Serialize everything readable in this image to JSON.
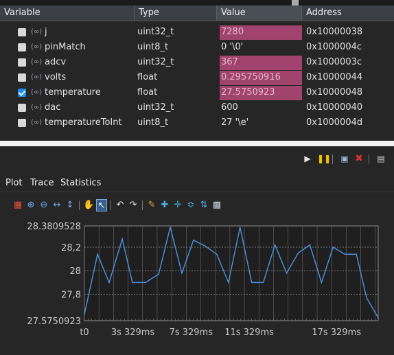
{
  "variables_table": {
    "columns": [
      "Variable",
      "Type",
      "Value",
      "Address"
    ],
    "rows": [
      {
        "name": "j",
        "type": "uint32_t",
        "value": "7280",
        "address": "0x10000038",
        "checked": false,
        "highlight": true
      },
      {
        "name": "pinMatch",
        "type": "uint8_t",
        "value": "0 '\\0'",
        "address": "0x1000004c",
        "checked": false,
        "highlight": false
      },
      {
        "name": "adcv",
        "type": "uint32_t",
        "value": "367",
        "address": "0x1000003c",
        "checked": false,
        "highlight": true
      },
      {
        "name": "volts",
        "type": "float",
        "value": "0.295750916",
        "address": "0x10000044",
        "checked": false,
        "highlight": true
      },
      {
        "name": "temperature",
        "type": "float",
        "value": "27.5750923",
        "address": "0x10000048",
        "checked": true,
        "highlight": true
      },
      {
        "name": "dac",
        "type": "uint32_t",
        "value": "600",
        "address": "0x10000040",
        "checked": false,
        "highlight": false
      },
      {
        "name": "temperatureToInt",
        "type": "uint8_t",
        "value": "27 '\\e'",
        "address": "0x1000004d",
        "checked": false,
        "highlight": false
      }
    ],
    "value_highlight_color": "#a0436d",
    "var_icon_glyph": "(∞)"
  },
  "plot_panel": {
    "tabs": [
      "Plot",
      "Trace",
      "Statistics"
    ],
    "active_tab": "Plot",
    "top_toolbar_icons": [
      "play-icon",
      "pause-icon",
      "save-icon",
      "close-icon",
      "settings-icon"
    ],
    "tool_icons": [
      "export-icon",
      "zoom-in-icon",
      "zoom-out-icon",
      "fit-horizontal-icon",
      "fit-vertical-icon",
      "pan-hand-icon",
      "select-pointer-icon",
      "undo-icon",
      "redo-icon",
      "marker-pen-icon",
      "add-cursor-icon",
      "remove-cursor-icon",
      "measure-icon",
      "scale-icon",
      "snapshot-icon"
    ],
    "active_tool": "select-pointer-icon",
    "line_color": "#4a8fd8"
  },
  "chart_data": {
    "type": "line",
    "ytick_labels": [
      "28.3809528",
      "28,2",
      "28",
      "27,8",
      "27.5750923"
    ],
    "ytick_values": [
      28.3809528,
      28.2,
      28.0,
      27.8,
      27.5750923
    ],
    "xtick_labels": [
      "t0",
      "3s 329ms",
      "7s 329ms",
      "11s 329ms",
      "17s 329ms"
    ],
    "xtick_values": [
      0,
      3.329,
      7.329,
      11.329,
      17.329
    ],
    "ylim": [
      27.5750923,
      28.3809528
    ],
    "xlim": [
      0,
      20.2
    ],
    "grid": true,
    "series": [
      {
        "x": [
          0,
          0.9,
          1.7,
          2.6,
          3.3,
          4.2,
          5.1,
          5.9,
          6.7,
          7.5,
          8.3,
          9.1,
          9.9,
          10.7,
          11.5,
          12.3,
          13.1,
          13.9,
          14.7,
          15.5,
          16.3,
          17.1,
          17.9,
          18.7,
          19.4,
          20.2
        ],
        "y": [
          27.63,
          28.14,
          27.9,
          28.27,
          27.9,
          27.9,
          27.97,
          28.37,
          27.98,
          28.26,
          28.21,
          28.14,
          27.9,
          28.37,
          27.9,
          27.9,
          28.22,
          27.98,
          28.15,
          28.22,
          27.9,
          28.2,
          28.14,
          28.14,
          27.77,
          27.6
        ]
      }
    ]
  }
}
